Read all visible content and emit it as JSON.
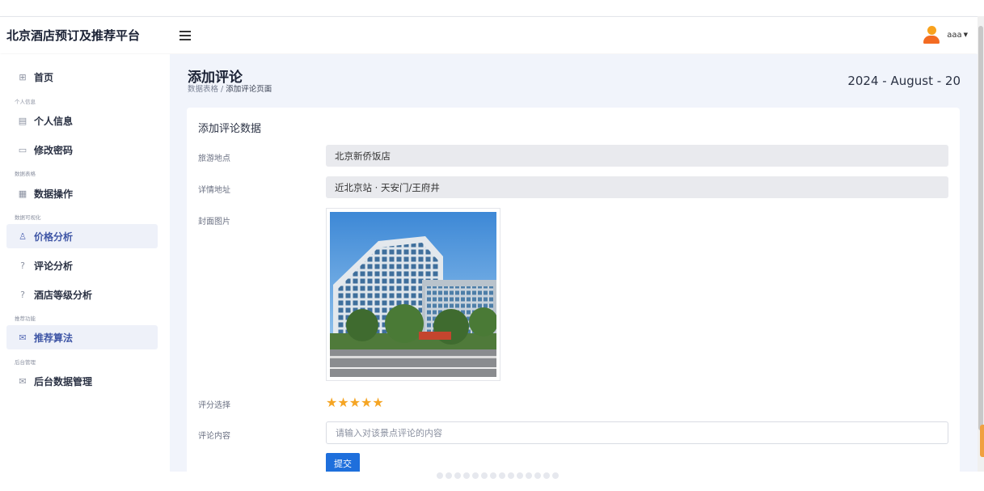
{
  "app": {
    "brand": "北京酒店预订及推荐平台"
  },
  "header": {
    "username": "aaa"
  },
  "sidebar": {
    "items": [
      {
        "label": "首页",
        "icon": "grid-icon"
      },
      {
        "section": "个人信息"
      },
      {
        "label": "个人信息",
        "icon": "profile-card-icon"
      },
      {
        "label": "修改密码",
        "icon": "document-icon"
      },
      {
        "section": "数据表格"
      },
      {
        "label": "数据操作",
        "icon": "table-icon"
      },
      {
        "section": "数据可视化"
      },
      {
        "label": "价格分析",
        "icon": "user-icon",
        "active": true
      },
      {
        "label": "评论分析",
        "icon": "question-circle-icon"
      },
      {
        "label": "酒店等级分析",
        "icon": "question-circle-icon"
      },
      {
        "section": "推荐功能"
      },
      {
        "label": "推荐算法",
        "icon": "mail-icon",
        "active": true
      },
      {
        "section": "后台管理"
      },
      {
        "label": "后台数据管理",
        "icon": "mail-icon"
      }
    ]
  },
  "page": {
    "title": "添加评论",
    "breadcrumb": {
      "parent": "数据表格",
      "separator": "/",
      "current": "添加评论页面"
    },
    "date": "2024 - August - 20"
  },
  "form": {
    "card_title": "添加评论数据",
    "location_label": "旅游地点",
    "location_value": "北京新侨饭店",
    "address_label": "详情地址",
    "address_value": "近北京站 · 天安门/王府井",
    "cover_label": "封面图片",
    "rating_label": "评分选择",
    "rating": 5,
    "stars": [
      "★",
      "★",
      "★",
      "★",
      "★"
    ],
    "comment_label": "评论内容",
    "comment_placeholder": "请输入对该景点评论的内容",
    "submit_label": "提交"
  },
  "colors": {
    "accent": "#1e6fdc",
    "sidebar_active_bg": "#eef1f9",
    "main_bg": "#f1f4fb",
    "star": "#f5a524"
  }
}
